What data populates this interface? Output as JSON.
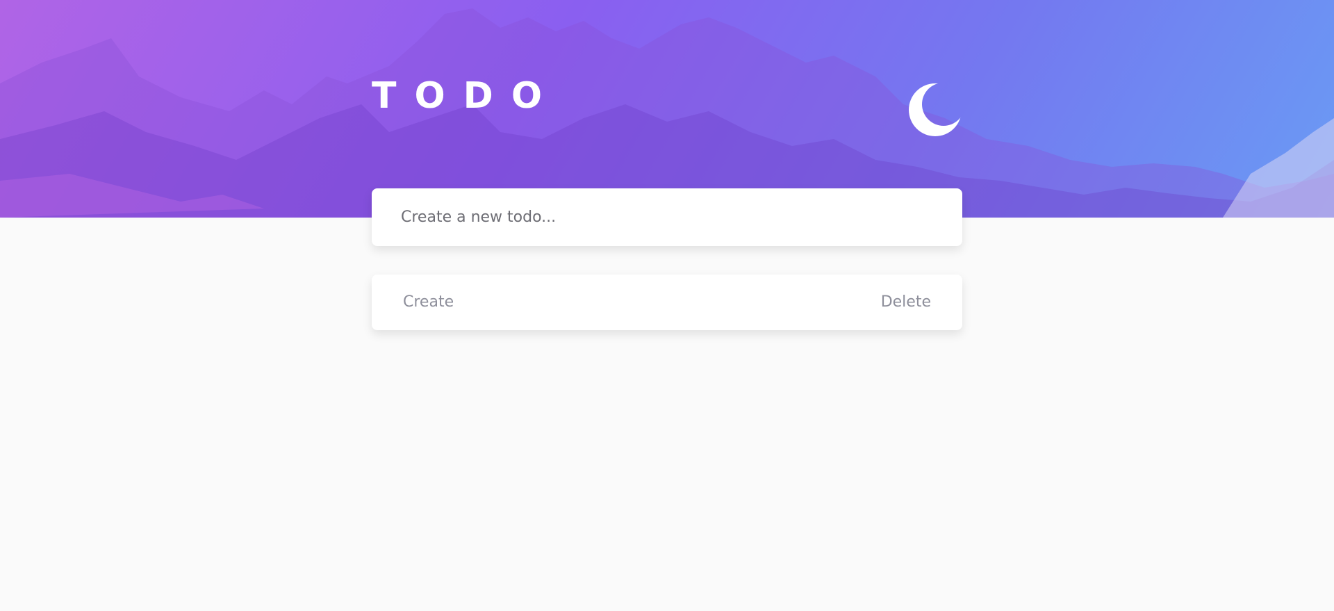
{
  "header": {
    "title": "TODO",
    "theme_toggle_icon": "moon-icon"
  },
  "new_todo": {
    "placeholder": "Create a new todo..."
  },
  "actions": {
    "create_label": "Create",
    "delete_label": "Delete"
  },
  "colors": {
    "gradient_start": "#b064e6",
    "gradient_end": "#6a9bf4",
    "background": "#fafafa",
    "action_text": "#8e8f9b"
  }
}
